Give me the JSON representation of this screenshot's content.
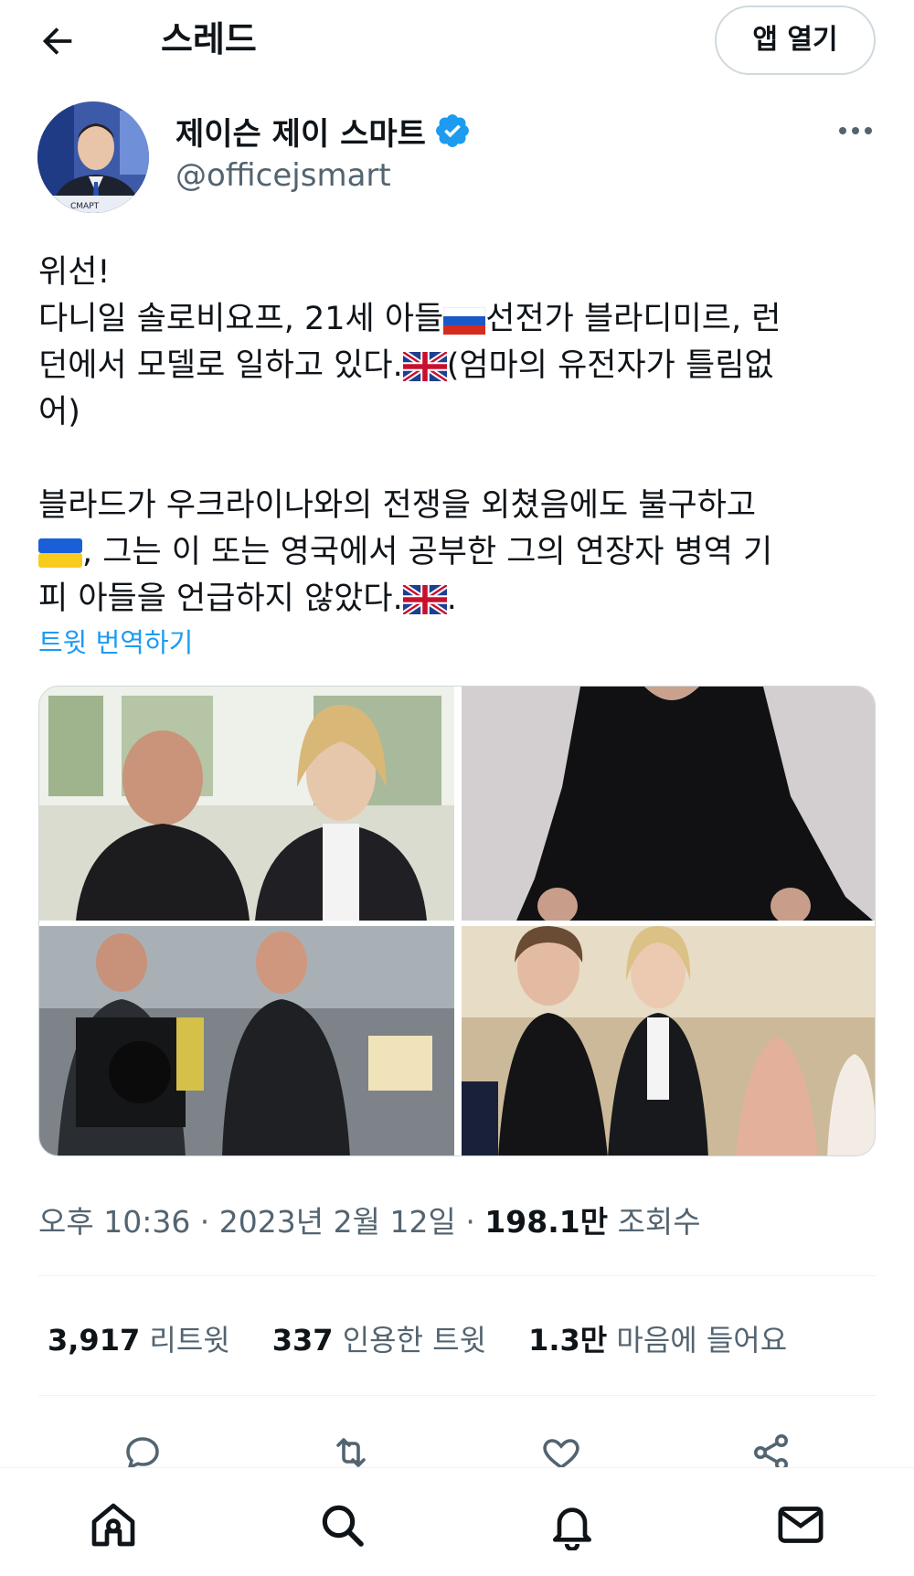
{
  "header": {
    "title": "스레드",
    "open_app_label": "앱 열기"
  },
  "author": {
    "display_name": "제이슨 제이 스마트",
    "handle": "@officejsmart",
    "avatar_caption": "СМАРТ"
  },
  "tweet": {
    "paragraph1_lines": [
      "위선!",
      "다니일 솔로비요프, 21세 아들",
      "선전가 블라디미르, 런",
      "던에서 모델로 일하고 있다.",
      "(엄마의 유전자가 틀림없",
      "어)"
    ],
    "paragraph2_lines": [
      "블라드가 우크라이나와의 전쟁을 외쳤음에도 불구하고",
      ", 그는 이 또는 영국에서 공부한 그의 연장자 병역 기",
      "피 아들을 언급하지 않았다.",
      "."
    ],
    "flags": [
      "russia-flag",
      "uk-flag",
      "ukraine-flag"
    ],
    "translate_label": "트윗 번역하기"
  },
  "meta": {
    "time": "오후 10:36",
    "sep": " · ",
    "date": "2023년 2월 12일",
    "views_count": "198.1만",
    "views_label": "조회수"
  },
  "stats": {
    "retweets_count": "3,917",
    "retweets_label": "리트윗",
    "quotes_count": "337",
    "quotes_label": "인용한 트윗",
    "likes_count": "1.3만",
    "likes_label": "마음에 들어요"
  },
  "icons": {
    "actions": [
      "reply-icon",
      "retweet-icon",
      "like-icon",
      "share-icon"
    ],
    "nav": [
      "home-icon",
      "search-icon",
      "notifications-icon",
      "messages-icon"
    ]
  },
  "colors": {
    "accent": "#1d9bf0",
    "text": "#0f1419",
    "secondary": "#536471",
    "border": "#cfd9de"
  }
}
